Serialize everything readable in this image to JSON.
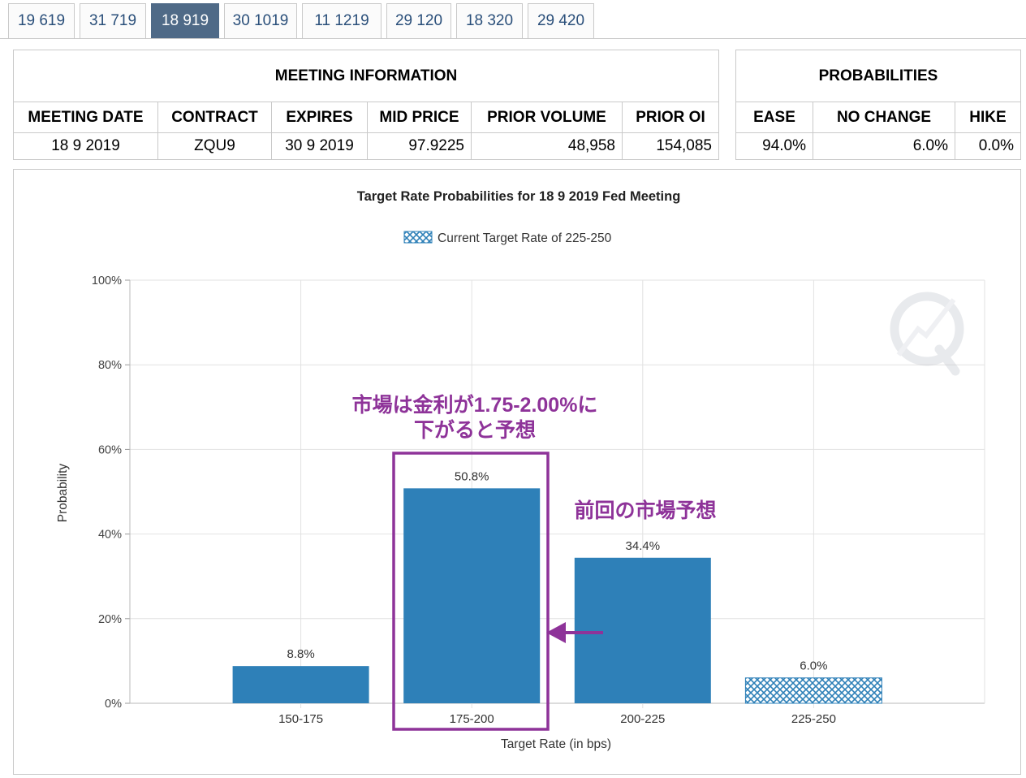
{
  "tabs": [
    {
      "label": "19 619",
      "active": false
    },
    {
      "label": "31 719",
      "active": false
    },
    {
      "label": "18 919",
      "active": true
    },
    {
      "label": "30 1019",
      "active": false
    },
    {
      "label": "11 1219",
      "active": false
    },
    {
      "label": "29 120",
      "active": false
    },
    {
      "label": "18 320",
      "active": false
    },
    {
      "label": "29 420",
      "active": false
    }
  ],
  "meeting_info": {
    "header": "MEETING INFORMATION",
    "columns": [
      "MEETING DATE",
      "CONTRACT",
      "EXPIRES",
      "MID PRICE",
      "PRIOR VOLUME",
      "PRIOR OI"
    ],
    "row": [
      "18 9 2019",
      "ZQU9",
      "30 9 2019",
      "97.9225",
      "48,958",
      "154,085"
    ]
  },
  "probabilities": {
    "header": "PROBABILITIES",
    "columns": [
      "EASE",
      "NO CHANGE",
      "HIKE"
    ],
    "row": [
      "94.0%",
      "6.0%",
      "0.0%"
    ]
  },
  "annotations": {
    "box_note_line1": "市場は金利が1.75-2.00%に",
    "box_note_line2": "下がると予想",
    "arrow_note": "前回の市場予想",
    "highlight_color": "#8e3399"
  },
  "chart_data": {
    "type": "bar",
    "title": "Target Rate Probabilities for 18 9 2019 Fed Meeting",
    "legend": "Current Target Rate of 225-250",
    "legend_position": "top-center",
    "xlabel": "Target Rate (in bps)",
    "ylabel": "Probability",
    "categories": [
      "150-175",
      "175-200",
      "200-225",
      "225-250"
    ],
    "values": [
      8.8,
      50.8,
      34.4,
      6.0
    ],
    "value_labels": [
      "8.8%",
      "50.8%",
      "34.4%",
      "6.0%"
    ],
    "current_target_category": "225-250",
    "yticks": [
      0,
      20,
      40,
      60,
      80,
      100
    ],
    "ytick_labels": [
      "0%",
      "20%",
      "40%",
      "60%",
      "80%",
      "100%"
    ],
    "ylim": [
      0,
      100
    ],
    "grid": true,
    "bar_color": "#2e80b8",
    "highlight_category": "175-200"
  }
}
